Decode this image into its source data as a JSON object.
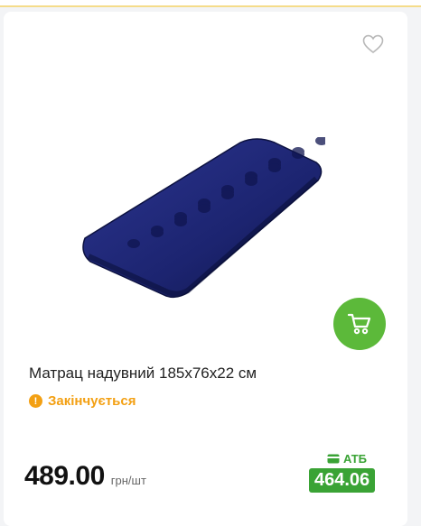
{
  "product": {
    "title": "Матрац надувний 185х76х22 см",
    "stock_status": "Закінчується",
    "price": "489.00",
    "price_unit": "грн/шт",
    "promo_store": "АТБ",
    "promo_price": "464.06"
  },
  "icons": {
    "favorite": "heart-outline-icon",
    "cart": "cart-icon",
    "stock": "exclamation-icon",
    "promo": "card-icon"
  },
  "colors": {
    "accent_green": "#5cb93a",
    "promo_green": "#3aa335",
    "warning_orange": "#f3a013",
    "mattress_blue": "#1c2470"
  }
}
